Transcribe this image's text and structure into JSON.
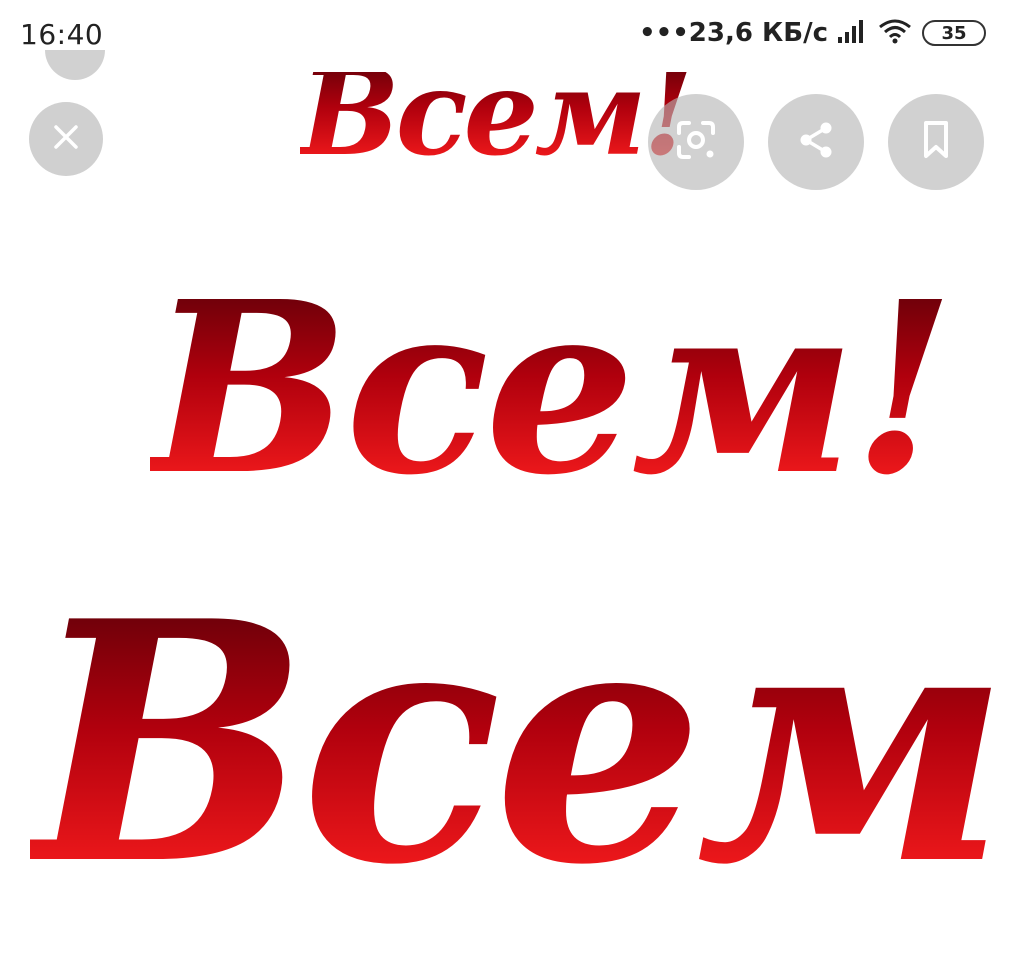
{
  "status_bar": {
    "time": "16:40",
    "network_speed": "•••23,6 КБ/с",
    "battery_level": "35"
  },
  "image": {
    "words": [
      "Всем!",
      "Всем!",
      "Всем!"
    ],
    "text_color": "#c40010"
  },
  "controls": {
    "close_icon": "close-icon",
    "lens_icon": "lens-icon",
    "share_icon": "share-icon",
    "bookmark_icon": "bookmark-icon",
    "button_color": "#b4b4b4"
  }
}
